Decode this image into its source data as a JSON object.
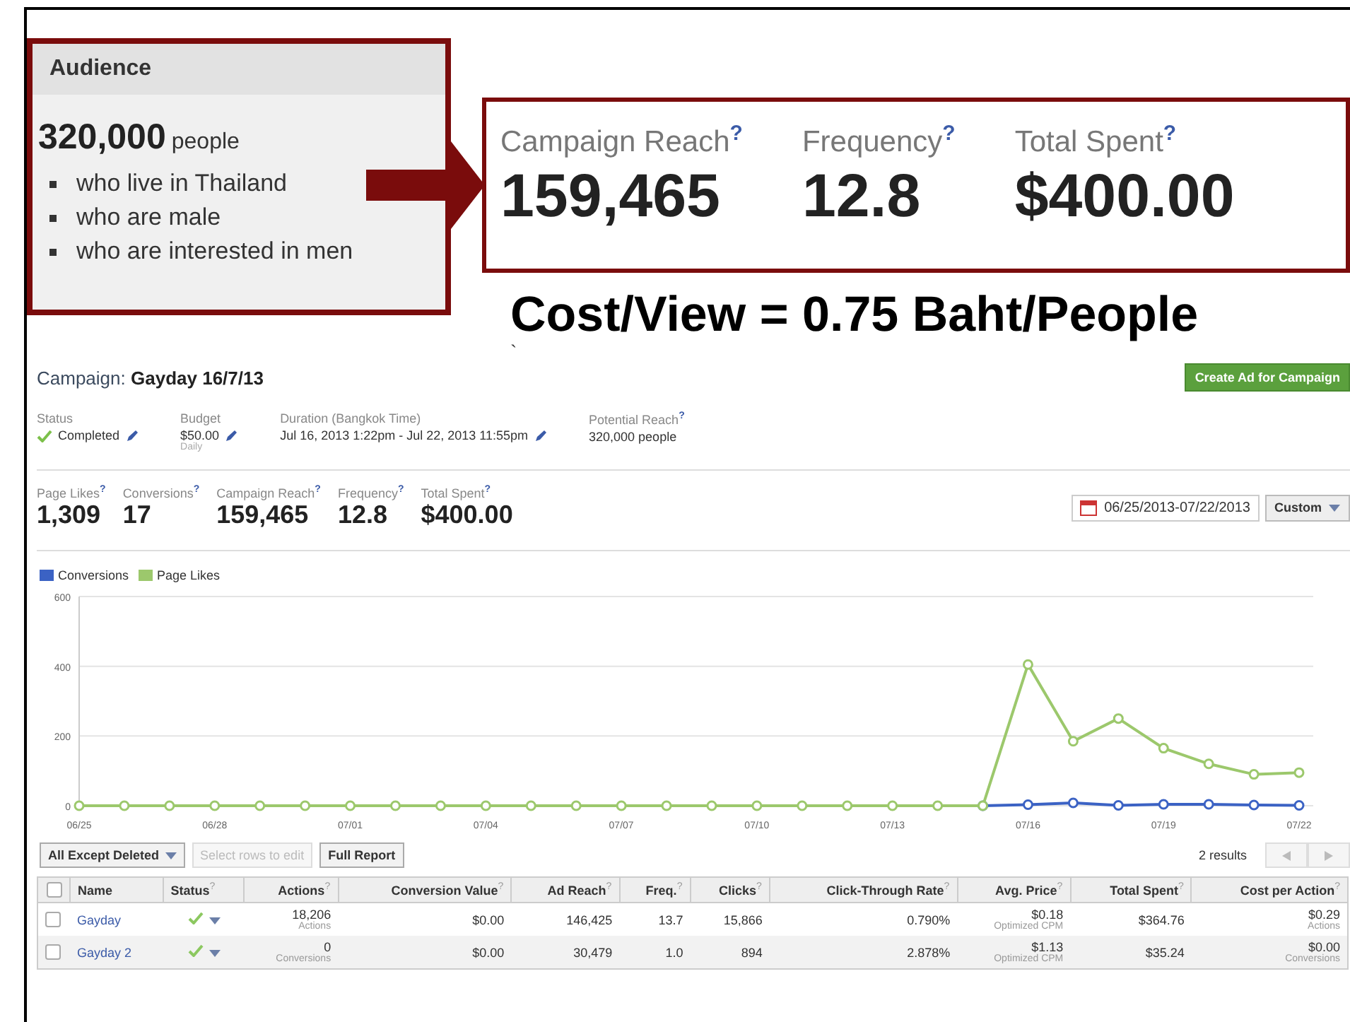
{
  "annotation": {
    "audience": {
      "title": "Audience",
      "count": "320,000",
      "unit": "people",
      "criteria": [
        "who live in Thailand",
        "who are male",
        "who are interested in men"
      ]
    },
    "highlight": [
      {
        "label": "Campaign Reach",
        "help": "?",
        "value": "159,465"
      },
      {
        "label": "Frequency",
        "help": "?",
        "value": "12.8"
      },
      {
        "label": "Total Spent",
        "help": "?",
        "value": "$400.00"
      }
    ],
    "note": "Cost/View = 0.75 Baht/People",
    "stray_mark": "`"
  },
  "report": {
    "campaign": {
      "label": "Campaign:",
      "name": "Gayday 16/7/13",
      "create_button": "Create Ad for Campaign"
    },
    "details": [
      {
        "label": "Status",
        "kind": "status",
        "value": "Completed",
        "editable": true
      },
      {
        "label": "Budget",
        "kind": "plain",
        "value": "$50.00",
        "sub": "Daily",
        "editable": true
      },
      {
        "label": "Duration (Bangkok Time)",
        "kind": "plain",
        "value": "Jul 16, 2013 1:22pm - Jul 22, 2013 11:55pm",
        "editable": true
      },
      {
        "label": "Potential Reach",
        "help": "?",
        "kind": "plain",
        "value": "320,000 people",
        "editable": false
      }
    ],
    "metrics": [
      {
        "label": "Page Likes",
        "help": "?",
        "value": "1,309"
      },
      {
        "label": "Conversions",
        "help": "?",
        "value": "17"
      },
      {
        "label": "Campaign Reach",
        "help": "?",
        "value": "159,465"
      },
      {
        "label": "Frequency",
        "help": "?",
        "value": "12.8"
      },
      {
        "label": "Total Spent",
        "help": "?",
        "value": "$400.00"
      }
    ],
    "date_range": "06/25/2013-07/22/2013",
    "range_select": "Custom",
    "chart": {
      "chart_data": {
        "type": "line",
        "categories": [
          "06/25",
          null,
          null,
          "06/28",
          null,
          null,
          "07/01",
          null,
          null,
          "07/04",
          null,
          null,
          "07/07",
          null,
          null,
          "07/10",
          null,
          null,
          "07/13",
          null,
          null,
          "07/16",
          null,
          null,
          "07/19",
          null,
          null,
          "07/22"
        ],
        "series": [
          {
            "name": "Conversions",
            "color": "#3b62c4",
            "marker": "circle",
            "values": [
              null,
              null,
              null,
              null,
              null,
              null,
              null,
              null,
              null,
              null,
              null,
              null,
              null,
              null,
              null,
              null,
              null,
              null,
              null,
              null,
              0,
              3,
              8,
              1,
              4,
              4,
              2,
              1
            ]
          },
          {
            "name": "Page Likes",
            "color": "#9cc86c",
            "marker": "circle",
            "values": [
              0,
              0,
              0,
              0,
              0,
              0,
              0,
              0,
              0,
              0,
              0,
              0,
              0,
              0,
              0,
              0,
              0,
              0,
              0,
              0,
              0,
              405,
              185,
              250,
              165,
              120,
              90,
              95
            ]
          }
        ],
        "ylim": [
          0,
          600
        ],
        "yticks": [
          0,
          200,
          400,
          600
        ]
      }
    },
    "toolbar": {
      "filter_select": "All Except Deleted",
      "edit_button": {
        "label": "Select rows to edit",
        "disabled": true
      },
      "report_button": "Full Report",
      "results": "2 results"
    },
    "table": {
      "header_checked": false,
      "columns": [
        {
          "label": "Name",
          "kind": "name"
        },
        {
          "label": "Status",
          "help": "?",
          "kind": "status"
        },
        {
          "label": "Actions",
          "help": "?",
          "kind": "number"
        },
        {
          "label": "Conversion Value",
          "help": "?",
          "kind": "number"
        },
        {
          "label": "Ad Reach",
          "help": "?",
          "kind": "number"
        },
        {
          "label": "Freq.",
          "help": "?",
          "kind": "number"
        },
        {
          "label": "Clicks",
          "help": "?",
          "kind": "number"
        },
        {
          "label": "Click-Through Rate",
          "help": "?",
          "kind": "number"
        },
        {
          "label": "Avg. Price",
          "help": "?",
          "kind": "number"
        },
        {
          "label": "Total Spent",
          "help": "?",
          "kind": "number"
        },
        {
          "label": "Cost per Action",
          "help": "?",
          "kind": "number"
        }
      ],
      "rows": [
        {
          "checked": false,
          "cells": [
            {
              "value": "Gayday"
            },
            {
              "completed": true
            },
            {
              "value": "18,206",
              "sub": "Actions"
            },
            {
              "value": "$0.00"
            },
            {
              "value": "146,425"
            },
            {
              "value": "13.7"
            },
            {
              "value": "15,866"
            },
            {
              "value": "0.790%"
            },
            {
              "value": "$0.18",
              "sub": "Optimized CPM"
            },
            {
              "value": "$364.76"
            },
            {
              "value": "$0.29",
              "sub": "Actions"
            }
          ]
        },
        {
          "checked": false,
          "cells": [
            {
              "value": "Gayday 2"
            },
            {
              "completed": true
            },
            {
              "value": "0",
              "sub": "Conversions"
            },
            {
              "value": "$0.00"
            },
            {
              "value": "30,479"
            },
            {
              "value": "1.0"
            },
            {
              "value": "894"
            },
            {
              "value": "2.878%"
            },
            {
              "value": "$1.13",
              "sub": "Optimized CPM"
            },
            {
              "value": "$35.24"
            },
            {
              "value": "$0.00",
              "sub": "Conversions"
            }
          ]
        }
      ]
    }
  }
}
